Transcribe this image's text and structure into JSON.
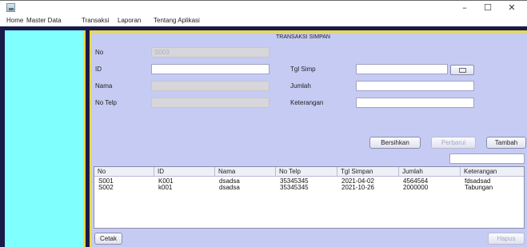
{
  "window": {
    "controls": {
      "minimize": "–",
      "maximize": "☐",
      "close": "✕"
    }
  },
  "menu": [
    "Home",
    "Master Data",
    "Transaksi",
    "Laporan",
    "Tentang Aplikasi"
  ],
  "form": {
    "title": "TRANSAKSI SIMPAN",
    "no_label": "No",
    "no_value": "S003",
    "id_label": "ID",
    "id_value": "",
    "nama_label": "Nama",
    "nama_value": "",
    "telp_label": "No Telp",
    "telp_value": "",
    "tgl_label": "Tgl Simp",
    "tgl_value": "",
    "jumlah_label": "Jumlah",
    "jumlah_value": "",
    "ket_label": "Keterangan",
    "ket_value": "",
    "search_value": ""
  },
  "buttons": {
    "bersihkan": "Bersihkan",
    "perbarui": "Perbarui",
    "tambah": "Tambah",
    "cetak": "Cetak",
    "hapus": "Hapus"
  },
  "table": {
    "columns": [
      "No",
      "ID",
      "Nama",
      "No Telp",
      "Tgl Simpan",
      "Jumlah",
      "Keterangan"
    ],
    "rows": [
      [
        "S001",
        "K001",
        "dsadsa",
        "35345345",
        "2021-04-02",
        "4564564",
        "fdsadsad"
      ],
      [
        "S002",
        "k001",
        "dsadsa",
        "35345345",
        "2021-10-26",
        "2000000",
        "Tabungan"
      ]
    ]
  },
  "colors": {
    "sidebar": "#80ffff",
    "content": "#c6cbf4",
    "accent_border": "#e8d84a",
    "frame": "#1a1a4a"
  }
}
